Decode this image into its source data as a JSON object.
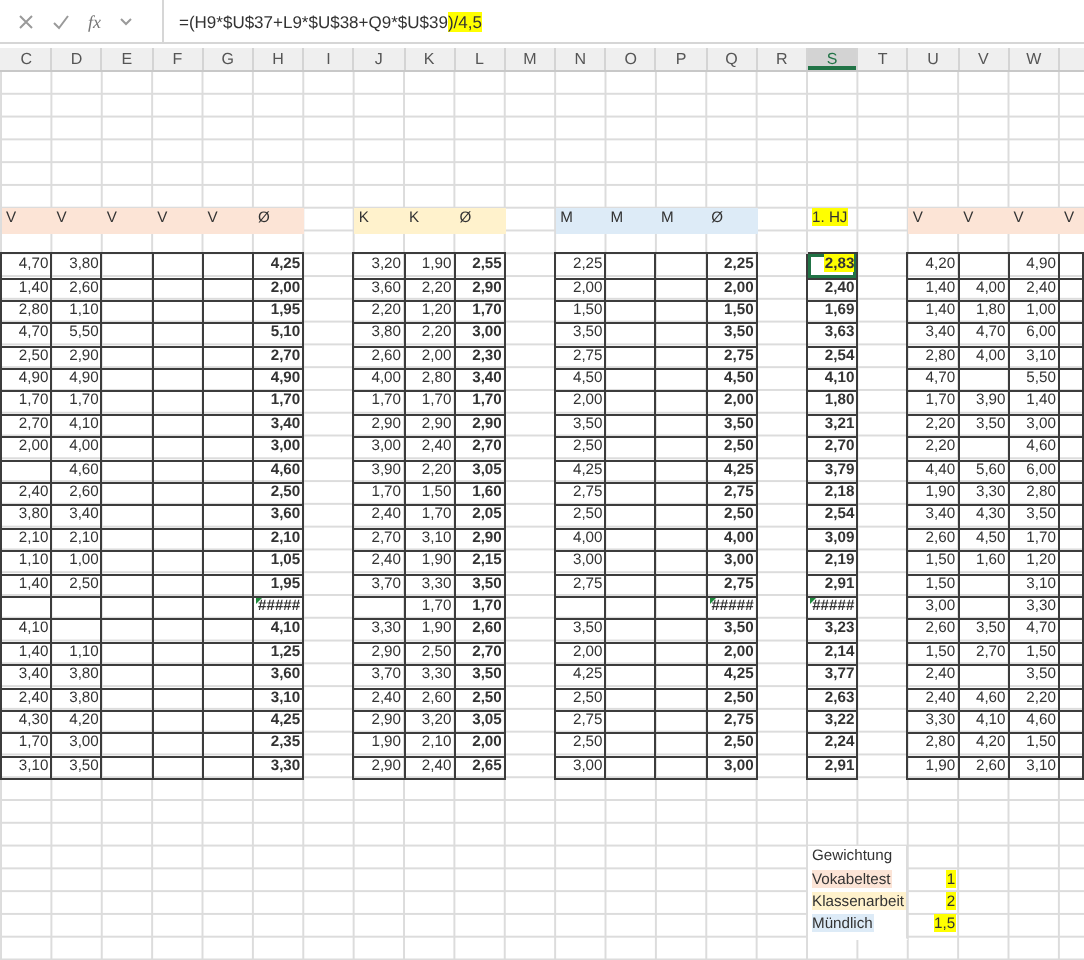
{
  "formula_bar": {
    "function_label": "fx",
    "formula": {
      "text": "=(H9*$U$37+L9*$U$38+Q9*$U$39",
      "highlighted_text": ")/4,5"
    }
  },
  "columns": [
    {
      "letter": "C",
      "selected": false
    },
    {
      "letter": "D",
      "selected": false
    },
    {
      "letter": "E",
      "selected": false
    },
    {
      "letter": "F",
      "selected": false
    },
    {
      "letter": "G",
      "selected": false
    },
    {
      "letter": "H",
      "selected": false
    },
    {
      "letter": "I",
      "selected": false
    },
    {
      "letter": "J",
      "selected": false
    },
    {
      "letter": "K",
      "selected": false
    },
    {
      "letter": "L",
      "selected": false
    },
    {
      "letter": "M",
      "selected": false
    },
    {
      "letter": "N",
      "selected": false
    },
    {
      "letter": "O",
      "selected": false
    },
    {
      "letter": "P",
      "selected": false
    },
    {
      "letter": "Q",
      "selected": false
    },
    {
      "letter": "R",
      "selected": false
    },
    {
      "letter": "S",
      "selected": true
    },
    {
      "letter": "T",
      "selected": false
    },
    {
      "letter": "U",
      "selected": false
    },
    {
      "letter": "V",
      "selected": false
    },
    {
      "letter": "W",
      "selected": false
    }
  ],
  "header_cells": [
    {
      "text": "V",
      "color": "#fce4d6"
    },
    {
      "text": "V",
      "color": "#fce4d6"
    },
    {
      "text": "V",
      "color": "#fce4d6"
    },
    {
      "text": "V",
      "color": "#fce4d6"
    },
    {
      "text": "V",
      "color": "#fce4d6"
    },
    {
      "text": "Ø",
      "color": "#fce4d6"
    },
    null,
    {
      "text": "K",
      "color": "#fff2cc"
    },
    {
      "text": "K",
      "color": "#fff2cc"
    },
    {
      "text": "Ø",
      "color": "#fff2cc"
    },
    null,
    {
      "text": "M",
      "color": "#ddebf7"
    },
    {
      "text": "M",
      "color": "#ddebf7"
    },
    {
      "text": "M",
      "color": "#ddebf7"
    },
    {
      "text": "Ø",
      "color": "#ddebf7"
    },
    null,
    {
      "text": "1. HJ",
      "highlighted": true
    },
    null,
    {
      "text": "V",
      "color": "#fce4d6"
    },
    {
      "text": "V",
      "color": "#fce4d6"
    },
    {
      "text": "V",
      "color": "#fce4d6"
    },
    {
      "text": "V",
      "color": "#fce4d6"
    }
  ],
  "rows": [
    {
      "selected": true,
      "cells": [
        "4,70",
        "3,80",
        null,
        null,
        null,
        "4,25",
        null,
        "3,20",
        "1,90",
        "2,55",
        null,
        "2,25",
        null,
        null,
        "2,25",
        null,
        {
          "text": "2,83",
          "highlighted": true
        },
        null,
        "4,20",
        null,
        "4,90"
      ]
    },
    {
      "selected": false,
      "cells": [
        "1,40",
        "2,60",
        null,
        null,
        null,
        "2,00",
        null,
        "3,60",
        "2,20",
        "2,90",
        null,
        "2,00",
        null,
        null,
        "2,00",
        null,
        "2,40",
        null,
        "1,40",
        "4,00",
        "2,40"
      ]
    },
    {
      "selected": false,
      "cells": [
        "2,80",
        "1,10",
        null,
        null,
        null,
        "1,95",
        null,
        "2,20",
        "1,20",
        "1,70",
        null,
        "1,50",
        null,
        null,
        "1,50",
        null,
        "1,69",
        null,
        "1,40",
        "1,80",
        "1,00"
      ]
    },
    {
      "selected": false,
      "cells": [
        "4,70",
        "5,50",
        null,
        null,
        null,
        "5,10",
        null,
        "3,80",
        "2,20",
        "3,00",
        null,
        "3,50",
        null,
        null,
        "3,50",
        null,
        "3,63",
        null,
        "3,40",
        "4,70",
        "6,00"
      ]
    },
    {
      "selected": false,
      "cells": [
        "2,50",
        "2,90",
        null,
        null,
        null,
        "2,70",
        null,
        "2,60",
        "2,00",
        "2,30",
        null,
        "2,75",
        null,
        null,
        "2,75",
        null,
        "2,54",
        null,
        "2,80",
        "4,00",
        "3,10"
      ]
    },
    {
      "selected": false,
      "cells": [
        "4,90",
        "4,90",
        null,
        null,
        null,
        "4,90",
        null,
        "4,00",
        "2,80",
        "3,40",
        null,
        "4,50",
        null,
        null,
        "4,50",
        null,
        "4,10",
        null,
        "4,70",
        null,
        "5,50"
      ]
    },
    {
      "selected": false,
      "cells": [
        "1,70",
        "1,70",
        null,
        null,
        null,
        "1,70",
        null,
        "1,70",
        "1,70",
        "1,70",
        null,
        "2,00",
        null,
        null,
        "2,00",
        null,
        "1,80",
        null,
        "1,70",
        "3,90",
        "1,40"
      ]
    },
    {
      "selected": false,
      "cells": [
        "2,70",
        "4,10",
        null,
        null,
        null,
        "3,40",
        null,
        "2,90",
        "2,90",
        "2,90",
        null,
        "3,50",
        null,
        null,
        "3,50",
        null,
        "3,21",
        null,
        "2,20",
        "3,50",
        "3,00"
      ]
    },
    {
      "selected": false,
      "cells": [
        "2,00",
        "4,00",
        null,
        null,
        null,
        "3,00",
        null,
        "3,00",
        "2,40",
        "2,70",
        null,
        "2,50",
        null,
        null,
        "2,50",
        null,
        "2,70",
        null,
        "2,20",
        null,
        "4,60"
      ]
    },
    {
      "selected": false,
      "cells": [
        null,
        "4,60",
        null,
        null,
        null,
        "4,60",
        null,
        "3,90",
        "2,20",
        "3,05",
        null,
        "4,25",
        null,
        null,
        "4,25",
        null,
        "3,79",
        null,
        "4,40",
        "5,60",
        "6,00"
      ]
    },
    {
      "selected": false,
      "cells": [
        "2,40",
        "2,60",
        null,
        null,
        null,
        "2,50",
        null,
        "1,70",
        "1,50",
        "1,60",
        null,
        "2,75",
        null,
        null,
        "2,75",
        null,
        "2,18",
        null,
        "1,90",
        "3,30",
        "2,80"
      ]
    },
    {
      "selected": false,
      "cells": [
        "3,80",
        "3,40",
        null,
        null,
        null,
        "3,60",
        null,
        "2,40",
        "1,70",
        "2,05",
        null,
        "2,50",
        null,
        null,
        "2,50",
        null,
        "2,54",
        null,
        "3,40",
        "4,30",
        "3,50"
      ]
    },
    {
      "selected": false,
      "cells": [
        "2,10",
        "2,10",
        null,
        null,
        null,
        "2,10",
        null,
        "2,70",
        "3,10",
        "2,90",
        null,
        "4,00",
        null,
        null,
        "4,00",
        null,
        "3,09",
        null,
        "2,60",
        "4,50",
        "1,70"
      ]
    },
    {
      "selected": false,
      "cells": [
        "1,10",
        "1,00",
        null,
        null,
        null,
        "1,05",
        null,
        "2,40",
        "1,90",
        "2,15",
        null,
        "3,00",
        null,
        null,
        "3,00",
        null,
        "2,19",
        null,
        "1,50",
        "1,60",
        "1,20"
      ]
    },
    {
      "selected": false,
      "cells": [
        "1,40",
        "2,50",
        null,
        null,
        null,
        "1,95",
        null,
        "3,70",
        "3,30",
        "3,50",
        null,
        "2,75",
        null,
        null,
        "2,75",
        null,
        "2,91",
        null,
        "1,50",
        null,
        "3,10"
      ]
    },
    {
      "selected": false,
      "cells": [
        null,
        null,
        null,
        null,
        null,
        {
          "text": "#####",
          "flagged": true
        },
        null,
        null,
        "1,70",
        "1,70",
        null,
        null,
        null,
        null,
        {
          "text": "#####",
          "flagged": true
        },
        null,
        {
          "text": "#####",
          "flagged": true
        },
        null,
        "3,00",
        null,
        "3,30"
      ]
    },
    {
      "selected": false,
      "cells": [
        "4,10",
        null,
        null,
        null,
        null,
        "4,10",
        null,
        "3,30",
        "1,90",
        "2,60",
        null,
        "3,50",
        null,
        null,
        "3,50",
        null,
        "3,23",
        null,
        "2,60",
        "3,50",
        "4,70"
      ]
    },
    {
      "selected": false,
      "cells": [
        "1,40",
        "1,10",
        null,
        null,
        null,
        "1,25",
        null,
        "2,90",
        "2,50",
        "2,70",
        null,
        "2,00",
        null,
        null,
        "2,00",
        null,
        "2,14",
        null,
        "1,50",
        "2,70",
        "1,50"
      ]
    },
    {
      "selected": false,
      "cells": [
        "3,40",
        "3,80",
        null,
        null,
        null,
        "3,60",
        null,
        "3,70",
        "3,30",
        "3,50",
        null,
        "4,25",
        null,
        null,
        "4,25",
        null,
        "3,77",
        null,
        "2,40",
        null,
        "3,50"
      ]
    },
    {
      "selected": false,
      "cells": [
        "2,40",
        "3,80",
        null,
        null,
        null,
        "3,10",
        null,
        "2,40",
        "2,60",
        "2,50",
        null,
        "2,50",
        null,
        null,
        "2,50",
        null,
        "2,63",
        null,
        "2,40",
        "4,60",
        "2,20"
      ]
    },
    {
      "selected": false,
      "cells": [
        "4,30",
        "4,20",
        null,
        null,
        null,
        "4,25",
        null,
        "2,90",
        "3,20",
        "3,05",
        null,
        "2,75",
        null,
        null,
        "2,75",
        null,
        "3,22",
        null,
        "3,30",
        "4,10",
        "4,60"
      ]
    },
    {
      "selected": false,
      "cells": [
        "1,70",
        "3,00",
        null,
        null,
        null,
        "2,35",
        null,
        "1,90",
        "2,10",
        "2,00",
        null,
        "2,50",
        null,
        null,
        "2,50",
        null,
        "2,24",
        null,
        "2,80",
        "4,20",
        "1,50"
      ]
    },
    {
      "selected": false,
      "cells": [
        "3,10",
        "3,50",
        null,
        null,
        null,
        "3,30",
        null,
        "2,90",
        "2,40",
        "2,65",
        null,
        "3,00",
        null,
        null,
        "3,00",
        null,
        "2,91",
        null,
        "1,90",
        "2,60",
        "3,10"
      ]
    }
  ],
  "weights": {
    "title": "Gewichtung",
    "items": [
      {
        "label": "Vokabeltest",
        "color": "#fce4d6",
        "value": "1",
        "highlighted": true
      },
      {
        "label": "Klassenarbeit",
        "color": "#fff2cc",
        "value": "2",
        "highlighted": true
      },
      {
        "label": "Mündlich",
        "color": "#ddebf7",
        "value": "1,5",
        "highlighted": true
      }
    ]
  }
}
